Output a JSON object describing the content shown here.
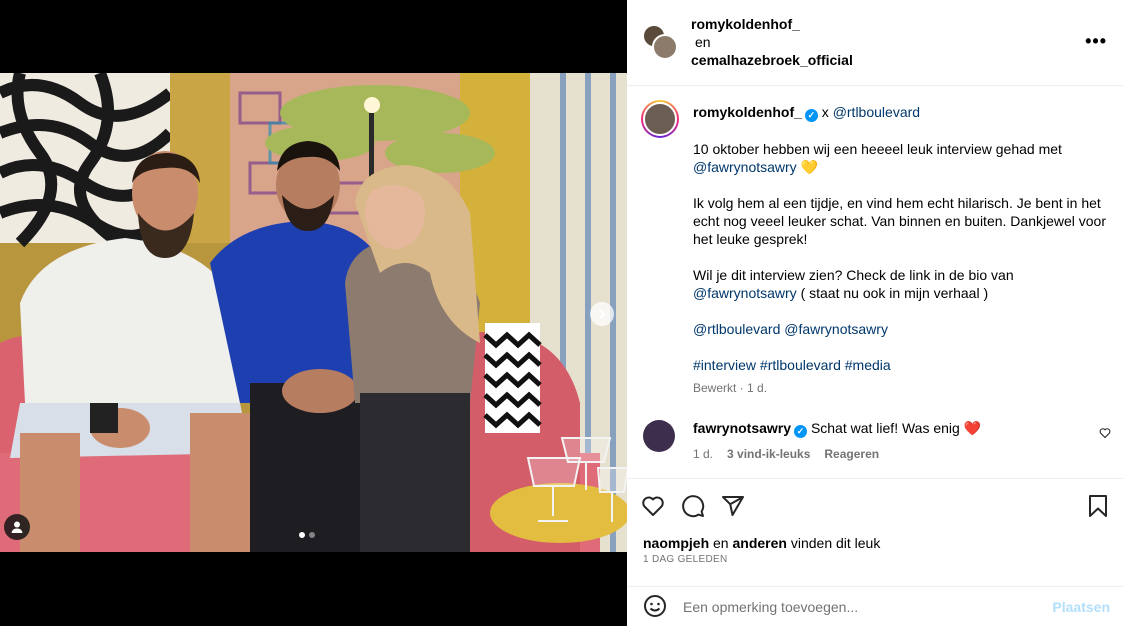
{
  "header": {
    "user1": "romykoldenhof_",
    "conjunction": "en",
    "user2": "cemalhazebroek_official",
    "more_icon": "more-horizontal-icon"
  },
  "caption": {
    "author": "romykoldenhof_",
    "x": "x",
    "collab": "@rtlboulevard",
    "p1_text": "10 oktober hebben wij een heeeel leuk interview gehad met",
    "p1_mention": "@fawrynotsawry",
    "p1_emoji": "💛",
    "p2": "Ik volg hem al een tijdje, en vind hem echt hilarisch. Je bent in het echt nog veeel leuker schat. Van binnen en buiten. Dankjewel voor het leuke gesprek!",
    "p3_text": "Wil je dit interview zien? Check de link in de bio van",
    "p3_mention": "@fawrynotsawry",
    "p3_tail": "( staat nu ook in mijn verhaal )",
    "mentions": [
      "@rtlboulevard",
      "@fawrynotsawry"
    ],
    "hashtags": [
      "#interview",
      "#rtlboulevard",
      "#media"
    ],
    "meta": "Bewerkt · 1 d."
  },
  "comment": {
    "user": "fawrynotsawry",
    "text": "Schat wat lief! Was enig",
    "emoji": "❤️",
    "time": "1 d.",
    "likes": "3 vind-ik-leuks",
    "reply": "Reageren"
  },
  "actions": {
    "liked_by_user": "naompjeh",
    "liked_mid": "en",
    "liked_others": "anderen",
    "liked_tail": "vinden dit leuk",
    "posted": "1 DAG GELEDEN"
  },
  "add_comment": {
    "placeholder": "Een opmerking toevoegen...",
    "post_label": "Plaatsen"
  },
  "carousel": {
    "current": 1,
    "total": 2
  },
  "colors": {
    "link": "#00376b",
    "verified": "#0095f6",
    "muted": "#737373",
    "post_button_disabled": "#b2dffc"
  }
}
